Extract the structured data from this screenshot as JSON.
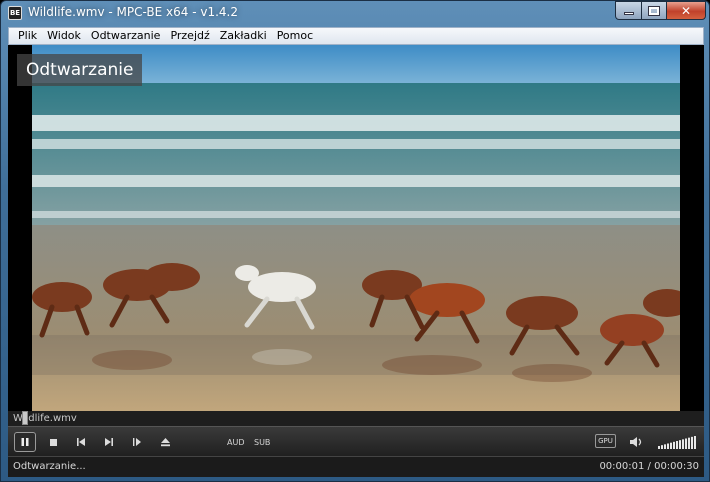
{
  "window": {
    "title": "Wildlife.wmv - MPC-BE x64 - v1.4.2",
    "icon_label": "BE"
  },
  "menu": [
    "Plik",
    "Widok",
    "Odtwarzanie",
    "Przejdź",
    "Zakładki",
    "Pomoc"
  ],
  "video": {
    "osd_text": "Odtwarzanie",
    "file_name": "Wildlife.wmv",
    "seek_progress": 0.03
  },
  "controls": {
    "play_pause_icon": "pause-icon",
    "stop_icon": "stop-icon",
    "prev_icon": "skip-back-icon",
    "next_icon": "skip-forward-icon",
    "frame_step_icon": "frame-step-icon",
    "eject_icon": "eject-icon",
    "audio_label": "AUD",
    "subtitle_label": "SUB",
    "gpu_label": "GPU",
    "volume_icon": "speaker-icon",
    "volume_level": 1.0
  },
  "status": {
    "state": "Odtwarzanie...",
    "time": "00:00:01 / 00:00:30"
  },
  "colors": {
    "titlebar": "#3f6e98",
    "close_button": "#c0412b",
    "controls_bg": "#2a2a2a",
    "sea": "#4a7e8c",
    "sky": "#4a93c8",
    "sand": "#b09c7a"
  }
}
